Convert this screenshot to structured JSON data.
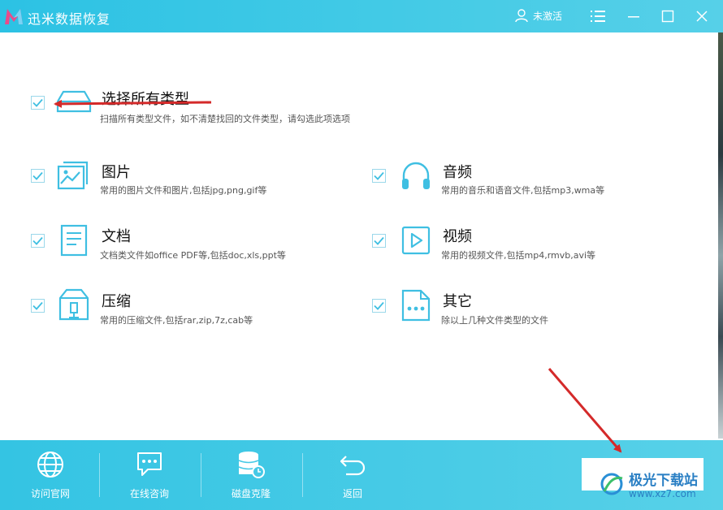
{
  "app": {
    "title": "迅米数据恢复",
    "brand_color": "#2cc2e4"
  },
  "header": {
    "user_label": "未激活"
  },
  "select_all": {
    "title": "选择所有类型",
    "desc": "扫描所有类型文件，如不清楚找回的文件类型，请勾选此项选项",
    "checked": true
  },
  "types": [
    {
      "title": "图片",
      "desc": "常用的图片文件和图片,包括jpg,png,gif等",
      "icon": "image-icon",
      "checked": true
    },
    {
      "title": "音频",
      "desc": "常用的音乐和语音文件,包括mp3,wma等",
      "icon": "headphones-icon",
      "checked": true
    },
    {
      "title": "文档",
      "desc": "文档类文件如office PDF等,包括doc,xls,ppt等",
      "icon": "document-icon",
      "checked": true
    },
    {
      "title": "视频",
      "desc": "常用的视频文件,包括mp4,rmvb,avi等",
      "icon": "video-icon",
      "checked": true
    },
    {
      "title": "压缩",
      "desc": "常用的压缩文件,包括rar,zip,7z,cab等",
      "icon": "archive-icon",
      "checked": true
    },
    {
      "title": "其它",
      "desc": "除以上几种文件类型的文件",
      "icon": "other-file-icon",
      "checked": true
    }
  ],
  "footer": {
    "buttons": [
      {
        "label": "访问官网",
        "icon": "globe-icon"
      },
      {
        "label": "在线咨询",
        "icon": "chat-icon"
      },
      {
        "label": "磁盘克隆",
        "icon": "disk-clone-icon"
      },
      {
        "label": "返回",
        "icon": "back-icon"
      }
    ]
  },
  "watermark": {
    "line1": "极光下载站",
    "line2": "www.xz7.com"
  },
  "annotation_color": "#d42a2a"
}
